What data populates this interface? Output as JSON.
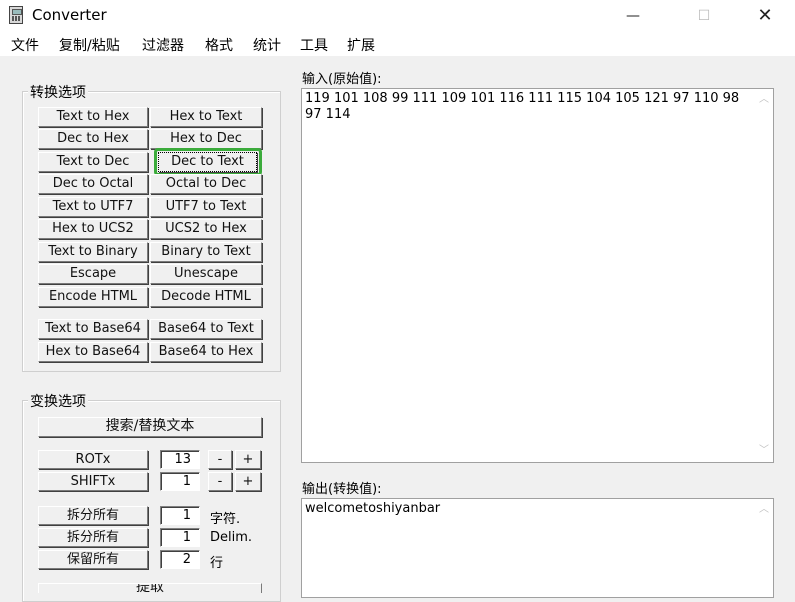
{
  "window": {
    "title": "Converter",
    "minimize": "—",
    "maximize": "☐",
    "close": "✕"
  },
  "menu": [
    "文件",
    "复制/粘贴",
    "过滤器",
    "格式",
    "统计",
    "工具",
    "扩展"
  ],
  "convert_group": {
    "label": "转换选项",
    "buttons": [
      "Text to Hex",
      "Hex to Text",
      "Dec to Hex",
      "Hex to Dec",
      "Text to Dec",
      "Dec to Text",
      "Dec to Octal",
      "Octal to Dec",
      "Text to UTF7",
      "UTF7 to Text",
      "Hex to UCS2",
      "UCS2 to Hex",
      "Text to Binary",
      "Binary to Text",
      "Escape",
      "Unescape",
      "Encode HTML",
      "Decode HTML",
      "Text to Base64",
      "Base64 to Text",
      "Hex to Base64",
      "Base64 to Hex"
    ]
  },
  "transform_group": {
    "label": "变换选项",
    "search_replace": "搜索/替换文本",
    "rot": {
      "label": "ROTx",
      "value": "13",
      "minus": "-",
      "plus": "+"
    },
    "shift": {
      "label": "SHIFTx",
      "value": "1",
      "minus": "-",
      "plus": "+"
    },
    "split_chars": {
      "label": "拆分所有",
      "value": "1",
      "unit": "字符."
    },
    "split_delim": {
      "label": "拆分所有",
      "value": "1",
      "unit": "Delim."
    },
    "keep_all": {
      "label": "保留所有",
      "value": "2",
      "unit": "行"
    },
    "extract": "提取"
  },
  "input": {
    "label": "输入(原始值):",
    "text": "119 101 108 99 111 109 101 116 111 115 104 105 121 97 110 98 97 114"
  },
  "output": {
    "label": "输出(转换值):",
    "text": "welcometoshiyanbar"
  }
}
